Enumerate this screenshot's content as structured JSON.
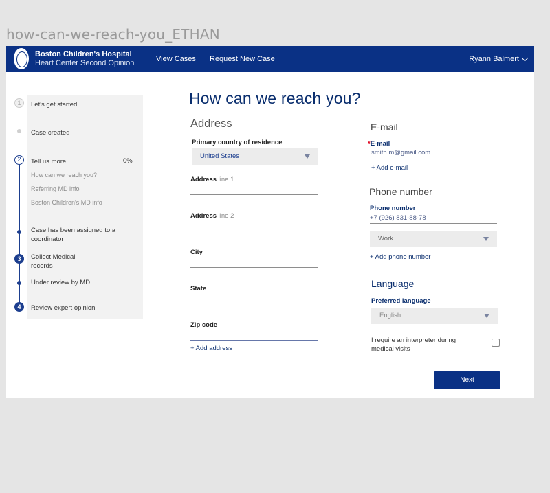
{
  "frame": {
    "title": "how-can-we-reach-you_ETHAN"
  },
  "header": {
    "brand_line1": "Boston Children's Hospital",
    "brand_line2": "Heart Center Second Opinion",
    "nav": [
      "View Cases",
      "Request New Case"
    ],
    "user_name": "Ryann Balmert"
  },
  "stepper": {
    "steps": [
      {
        "number": "1",
        "label": "Let's get started"
      },
      {
        "label": "Case created"
      },
      {
        "number": "2",
        "label": "Tell us more",
        "percent": "0%"
      },
      {
        "label": "Case has been assigned to a coordinator"
      },
      {
        "number": "3",
        "label": "Collect Medical records"
      },
      {
        "label": "Under review by MD"
      },
      {
        "number": "4",
        "label": "Review expert opinion"
      }
    ],
    "substeps": [
      "How can we reach you?",
      "Referring MD info",
      "Boston Children's MD info"
    ]
  },
  "page_title": "How can we reach you?",
  "address": {
    "heading": "Address",
    "country_label": "Primary country of residence",
    "country_value": "United States",
    "line1_label": "Address",
    "line1_suffix": "line 1",
    "line2_label": "Address",
    "line2_suffix": "line 2",
    "city_label": "City",
    "state_label": "State",
    "zip_label": "Zip code",
    "add_label": "+ Add address"
  },
  "email": {
    "heading": "E-mail",
    "required_mark": "*",
    "label": "E-mail",
    "value": "smith.m@gmail.com",
    "add_label": "+ Add e-mail"
  },
  "phone": {
    "heading": "Phone number",
    "label": "Phone number",
    "value": "+7 (926) 831-88-78",
    "type_value": "Work",
    "add_label": "+ Add phone number"
  },
  "language": {
    "heading": "Language",
    "label": "Preferred language",
    "value": "English",
    "interpreter_label": "I require an interpreter during medical visits"
  },
  "actions": {
    "next_label": "Next"
  },
  "colors": {
    "navy": "#0a3185",
    "accent": "#1d3f8f",
    "required": "#e0001b"
  }
}
